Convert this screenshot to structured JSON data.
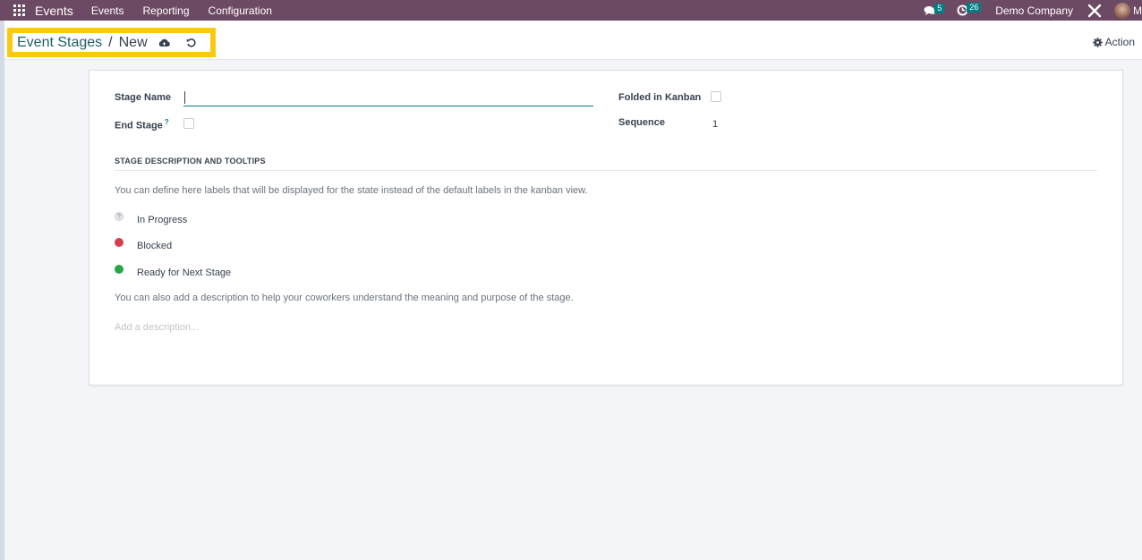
{
  "navbar": {
    "app_name": "Events",
    "menu": [
      "Events",
      "Reporting",
      "Configuration"
    ],
    "messages_count": "5",
    "activities_count": "26",
    "company": "Demo Company",
    "user_initial": "M"
  },
  "control_panel": {
    "breadcrumb_parent": "Event Stages",
    "breadcrumb_separator": "/",
    "breadcrumb_current": "New",
    "action_label": "Action"
  },
  "form": {
    "stage_name_label": "Stage Name",
    "stage_name_value": "",
    "end_stage_label": "End Stage",
    "end_stage_help": "?",
    "end_stage_checked": false,
    "folded_label": "Folded in Kanban",
    "folded_checked": false,
    "sequence_label": "Sequence",
    "sequence_value": "1",
    "section_title": "STAGE DESCRIPTION AND TOOLTIPS",
    "labels_help": "You can define here labels that will be displayed for the state instead of the default labels in the kanban view.",
    "states": [
      {
        "label": "In Progress",
        "color": "#e5e7eb"
      },
      {
        "label": "Blocked",
        "color": "#d23f4f"
      },
      {
        "label": "Ready for Next Stage",
        "color": "#28a745"
      }
    ],
    "description_help": "You can also add a description to help your coworkers understand the meaning and purpose of the stage.",
    "description_placeholder": "Add a description..."
  },
  "colors": {
    "navbar": "#6d4a63",
    "accent": "#017e84",
    "highlight": "#fbc90f"
  }
}
